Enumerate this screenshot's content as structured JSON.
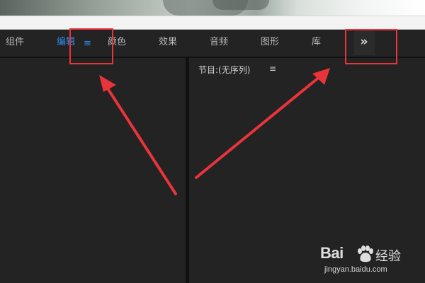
{
  "tabs": [
    {
      "label": "组件",
      "active": false
    },
    {
      "label": "编辑",
      "active": true
    },
    {
      "label": "颜色",
      "active": false
    },
    {
      "label": "效果",
      "active": false
    },
    {
      "label": "音频",
      "active": false
    },
    {
      "label": "图形",
      "active": false
    },
    {
      "label": "库",
      "active": false
    }
  ],
  "tab_menu_icon": "≡",
  "overflow_button": "»",
  "program_panel": {
    "title": "节目:(无序列)",
    "menu_icon": "≡"
  },
  "watermark": {
    "brand_left": "Bai",
    "brand_right": "经验",
    "url": "jingyan.baidu.com"
  },
  "colors": {
    "active_tab": "#2d8ceb",
    "annotation_red": "#e8343a",
    "panel_bg": "#232323"
  },
  "icons": {
    "tab_menu": "hamburger-icon",
    "overflow": "double-chevron-right-icon",
    "program_menu": "hamburger-icon",
    "watermark_logo": "baidu-paw-icon"
  }
}
